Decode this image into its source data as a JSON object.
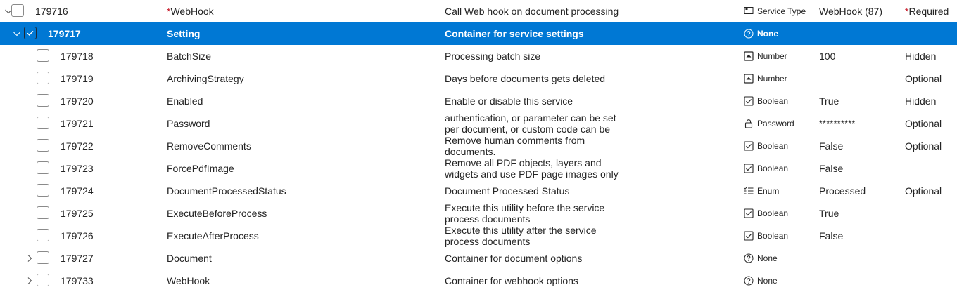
{
  "rows": [
    {
      "id": "179716",
      "name": "WebHook",
      "required_mark": "*",
      "description": "Call Web hook on document processing",
      "type_icon": "service-type-icon",
      "type": "Service Type",
      "value": "WebHook (87)",
      "status_mark": "*",
      "status": "Required",
      "expander": "expanded",
      "level": 0,
      "selected": false
    },
    {
      "id": "179717",
      "name": "Setting",
      "description": "Container for service settings",
      "type_icon": "question-circle-icon",
      "type": "None",
      "value": "",
      "status": "",
      "expander": "expanded",
      "level": 1,
      "selected": true
    },
    {
      "id": "179718",
      "name": "BatchSize",
      "description": "Processing batch size",
      "type_icon": "number-icon",
      "type": "Number",
      "value": "100",
      "status": "Hidden",
      "level": 2
    },
    {
      "id": "179719",
      "name": "ArchivingStrategy",
      "description": "Days before documents gets deleted",
      "type_icon": "number-icon",
      "type": "Number",
      "value": "",
      "status": "Optional",
      "level": 2
    },
    {
      "id": "179720",
      "name": "Enabled",
      "description": "Enable or disable this service",
      "type_icon": "checkbox-icon",
      "type": "Boolean",
      "value": "True",
      "status": "Hidden",
      "level": 2
    },
    {
      "id": "179721",
      "name": "Password",
      "description": "authentication, or parameter can be set per document, or custom code can be",
      "type_icon": "lock-icon",
      "type": "Password",
      "value": "**********",
      "status": "Optional",
      "level": 2
    },
    {
      "id": "179722",
      "name": "RemoveComments",
      "description": "Remove human comments from documents.",
      "type_icon": "checkbox-icon",
      "type": "Boolean",
      "value": "False",
      "status": "Optional",
      "level": 2
    },
    {
      "id": "179723",
      "name": "ForcePdfImage",
      "description": "Remove all PDF objects, layers and widgets and use PDF page images only",
      "type_icon": "checkbox-icon",
      "type": "Boolean",
      "value": "False",
      "status": "",
      "level": 2
    },
    {
      "id": "179724",
      "name": "DocumentProcessedStatus",
      "description": "Document Processed Status",
      "type_icon": "enum-list-icon",
      "type": "Enum",
      "value": "Processed",
      "status": "Optional",
      "level": 2
    },
    {
      "id": "179725",
      "name": "ExecuteBeforeProcess",
      "description": "Execute this utility before the service process documents",
      "type_icon": "checkbox-icon",
      "type": "Boolean",
      "value": "True",
      "status": "",
      "level": 2
    },
    {
      "id": "179726",
      "name": "ExecuteAfterProcess",
      "description": "Execute this utility after the service process documents",
      "type_icon": "checkbox-icon",
      "type": "Boolean",
      "value": "False",
      "status": "",
      "level": 2
    },
    {
      "id": "179727",
      "name": "Document",
      "description": "Container for document options",
      "type_icon": "question-circle-icon",
      "type": "None",
      "value": "",
      "status": "",
      "expander": "collapsed",
      "level": 2
    },
    {
      "id": "179733",
      "name": "WebHook",
      "description": "Container for webhook options",
      "type_icon": "question-circle-icon",
      "type": "None",
      "value": "",
      "status": "",
      "expander": "collapsed",
      "level": 2
    }
  ]
}
